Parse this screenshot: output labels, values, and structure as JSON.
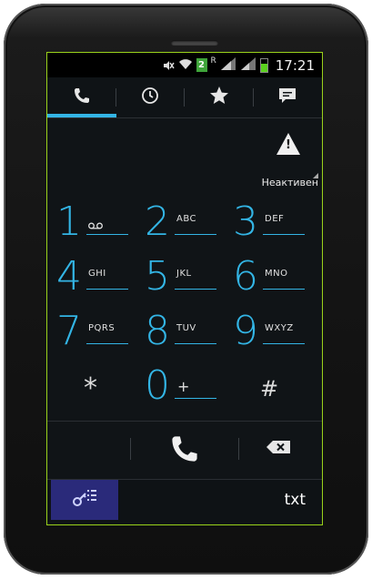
{
  "status_bar": {
    "sim_number": "2",
    "roaming_indicator": "R",
    "time": "17:21",
    "icons": [
      "mute-icon",
      "wifi-icon",
      "sim-icon",
      "signal-icon",
      "battery-icon"
    ]
  },
  "tabs": [
    {
      "name": "phone",
      "icon": "phone-icon",
      "active": true
    },
    {
      "name": "recent",
      "icon": "clock-icon",
      "active": false
    },
    {
      "name": "favorites",
      "icon": "star-icon",
      "active": false
    },
    {
      "name": "contacts",
      "icon": "contacts-card-icon",
      "active": false
    }
  ],
  "status": {
    "warning_icon": "warning-icon",
    "label": "Неактивен"
  },
  "keypad": {
    "k1": {
      "digit": "1",
      "letters": ""
    },
    "k2": {
      "digit": "2",
      "letters": "ABC"
    },
    "k3": {
      "digit": "3",
      "letters": "DEF"
    },
    "k4": {
      "digit": "4",
      "letters": "GHI"
    },
    "k5": {
      "digit": "5",
      "letters": "JKL"
    },
    "k6": {
      "digit": "6",
      "letters": "MNO"
    },
    "k7": {
      "digit": "7",
      "letters": "PQRS"
    },
    "k8": {
      "digit": "8",
      "letters": "TUV"
    },
    "k9": {
      "digit": "9",
      "letters": "WXYZ"
    },
    "star": {
      "symbol": "*"
    },
    "k0": {
      "digit": "0",
      "letters": "+"
    },
    "hash": {
      "symbol": "#"
    }
  },
  "actions": {
    "call_icon": "phone-call-icon",
    "delete_icon": "backspace-icon"
  },
  "keyboard_bar": {
    "toggle_icon": "dialpad-toggle-icon",
    "txt_label": "txt"
  },
  "colors": {
    "accent": "#33b5e5",
    "screen_border": "#9ad21b",
    "keyboard_toggle_bg": "#2a2a7a"
  }
}
